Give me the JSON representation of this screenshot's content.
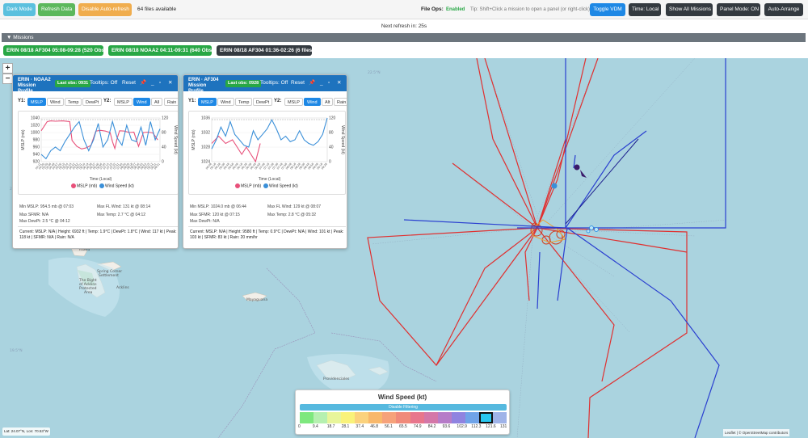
{
  "toolbar": {
    "dark_mode": "Dark Mode",
    "refresh_data": "Refresh Data",
    "disable_auto_refresh": "Disable Auto-refresh",
    "files_available": "64 files available",
    "file_ops_label": "File Ops:",
    "file_ops_status": "Enabled",
    "tip": "Tip: Shift+Click a mission to open a panel (or right-click)",
    "toggle_vdm": "Toggle VDM",
    "time_mode": "Time: Local",
    "show_all_missions": "Show All Missions",
    "panel_mode": "Panel Mode: ON",
    "auto_arrange": "Auto-Arrange",
    "colors": {
      "dark_mode": "#5bc0de",
      "refresh": "#5cb85c",
      "disable_refresh": "#f0ad4e",
      "toggle_vdm": "#1e88e5",
      "dark": "#343a40",
      "enabled": "#28a745"
    }
  },
  "refresh": {
    "text": "Next refresh in: 25s"
  },
  "missions": {
    "header": "▼ Missions",
    "tabs": [
      {
        "label": "ERIN 08/18 AF304 05:08-09:28 (520 Obs)",
        "color": "#28a745"
      },
      {
        "label": "ERIN 08/18 NOAA2 04:11-09:31 (640 Obs)",
        "color": "#28a745"
      },
      {
        "label": "ERIN 08/18 AF304 01:36-02:26 (6 files)",
        "color": "#343a40"
      }
    ]
  },
  "map": {
    "zoom_in": "+",
    "zoom_out": "−",
    "labels": {
      "island": "Island",
      "bight1": "The Bight",
      "bight2": "of Acklins",
      "bight3": "Protected",
      "bight4": "Area",
      "spring1": "Spring Corner",
      "spring2": "Settlement",
      "acklins": "Acklins",
      "mayaguana": "Mayaguana",
      "providenciales": "Providenciales"
    },
    "lat_labels": [
      "22.5°N",
      "21.0°N",
      "19.5°N"
    ],
    "coords": "Lat: 24.07°N, Lon: 70.53°W",
    "attribution": "Leaflet | © OpenStreetMap contributors"
  },
  "panel_noaa2": {
    "title_line1": "ERIN · NOAA2",
    "title_line2": "Mission Profile",
    "last_obs": "Last obs: 0931",
    "tooltips": "Tooltips: Off",
    "reset": "Reset",
    "y1_label": "Y1:",
    "y2_label": "Y2:",
    "y1_buttons": [
      "MSLP",
      "Wind",
      "Temp",
      "DewPt"
    ],
    "y2_buttons": [
      "MSLP",
      "Wind",
      "All",
      "Rain"
    ],
    "chart_y1_label": "MSLP (mb)",
    "chart_y2_label": "Wind Speed (kt)",
    "chart_x_label": "Time (Local)",
    "y1_ticks": [
      "1040",
      "1020",
      "1000",
      "980",
      "960",
      "940",
      "920"
    ],
    "y2_ticks": [
      "120",
      "80",
      "40",
      "0"
    ],
    "x_ticks": [
      "04:11",
      "04:20",
      "04:29",
      "04:38",
      "04:48",
      "04:57",
      "05:06",
      "05:15",
      "05:24",
      "05:33",
      "05:42",
      "05:52",
      "06:01",
      "06:10",
      "06:19",
      "06:28",
      "06:37",
      "06:46",
      "06:56",
      "07:05",
      "07:14",
      "07:23",
      "07:32",
      "07:41",
      "07:50",
      "08:00",
      "08:09",
      "08:18",
      "08:27",
      "08:36",
      "08:45",
      "08:54",
      "09:03",
      "09:12",
      "09:21",
      "09:31"
    ],
    "legend_mslp": "MSLP (mb)",
    "legend_wind": "Wind Speed (kt)",
    "stats": {
      "min_mslp": "Min MSLP: 954.5 mb @ 07:03",
      "max_fl_wind": "Max FL Wind: 131 kt @ 08:14",
      "max_sfmr": "Max SFMR: N/A",
      "max_temp": "Max Temp: 2.7 °C @ 04:12",
      "max_dewpt": "Max DewPt: 2.5 °C @ 04:12"
    },
    "current": "Current: MSLP: N/A | Height: 6932 ft | Temp: 1.9°C | DewPt: 1.8°C | Wind: 117 kt | Peak: 118 kt | SFMR: N/A | Rain: N/A"
  },
  "panel_af304": {
    "title_line1": "ERIN · AF304",
    "title_line2": "Mission Profile",
    "last_obs": "Last obs: 0928",
    "tooltips": "Tooltips: Off",
    "reset": "Reset",
    "y1_label": "Y1:",
    "y2_label": "Y2:",
    "y1_buttons": [
      "MSLP",
      "Wind",
      "Temp",
      "DewPt"
    ],
    "y2_buttons": [
      "MSLP",
      "Wind",
      "Alt",
      "Rain"
    ],
    "chart_y1_label": "MSLP (mb)",
    "chart_y2_label": "Wind Speed (kt)",
    "chart_x_label": "Time (Local)",
    "y1_ticks": [
      "1036",
      "1032",
      "1028",
      "1024"
    ],
    "y2_ticks": [
      "120",
      "80",
      "40",
      "0"
    ],
    "x_ticks": [
      "05:08",
      "05:18",
      "05:28",
      "05:38",
      "05:48",
      "05:58",
      "06:08",
      "06:18",
      "06:28",
      "06:38",
      "06:48",
      "06:58",
      "07:08",
      "07:18",
      "07:28",
      "07:38",
      "07:48",
      "07:58",
      "08:08",
      "08:18",
      "08:28",
      "08:38",
      "08:48",
      "08:58",
      "09:08",
      "09:18",
      "09:28"
    ],
    "legend_mslp": "MSLP (mb)",
    "legend_wind": "Wind Speed (kt)",
    "stats": {
      "min_mslp": "Min MSLP: 1024.0 mb @ 06:44",
      "max_fl_wind": "Max FL Wind: 129 kt @ 08:07",
      "max_sfmr": "Max SFMR: 120 kt @ 07:15",
      "max_temp": "Max Temp: 2.8 °C @ 05:32",
      "max_dewpt": "Max DewPt: N/A"
    },
    "current": "Current: MSLP: N/A | Height: 9580 ft | Temp: 0.9°C | DewPt: N/A | Wind: 101 kt | Peak: 103 kt | SFMR: 83 kt | Rain: 20 mm/hr"
  },
  "wind_legend": {
    "title": "Wind Speed (kt)",
    "filter_button": "Disable Filtering",
    "ticks": [
      "0",
      "9.4",
      "18.7",
      "28.1",
      "37.4",
      "46.8",
      "56.1",
      "65.5",
      "74.9",
      "84.2",
      "93.6",
      "102.9",
      "112.3",
      "121.6",
      "131"
    ],
    "colors": [
      "#7ee87e",
      "#b6f0b0",
      "#e8f59a",
      "#f9f27a",
      "#fbd27d",
      "#f8b86b",
      "#f6a27a",
      "#f08a7a",
      "#e8768c",
      "#d477a8",
      "#b67cc8",
      "#8f83e0",
      "#6fa3e8",
      "#28c8f0",
      "#9fb3e8"
    ],
    "selected_index": 13
  },
  "chart_data": [
    {
      "type": "line",
      "title": "",
      "xlabel": "Time (Local)",
      "ylabel": "MSLP (mb)",
      "y2label": "Wind Speed (kt)",
      "ylim": [
        920,
        1040
      ],
      "y2lim": [
        0,
        120
      ],
      "series": [
        {
          "name": "MSLP (mb)",
          "axis": "y1",
          "color": "#e8507a",
          "x": [
            0,
            0.05,
            0.08,
            0.12,
            0.18,
            0.24,
            0.26,
            0.3,
            0.34,
            0.38,
            0.42,
            0.46,
            0.5,
            0.54,
            0.58,
            0.6,
            0.62,
            0.64,
            0.66,
            0.7,
            0.74,
            0.78,
            0.82,
            0.86,
            0.9,
            0.94,
            0.98
          ],
          "y": [
            1005,
            1030,
            1032,
            1031,
            1032,
            1030,
            978,
            962,
            955,
            958,
            965,
            1004,
            1006,
            1004,
            1000,
            975,
            956,
            985,
            1005,
            1004,
            1000,
            1001,
            962,
            1000,
            1001,
            999,
            980
          ]
        },
        {
          "name": "Wind Speed (kt)",
          "axis": "y2",
          "color": "#3a8fd8",
          "x": [
            0,
            0.04,
            0.08,
            0.12,
            0.16,
            0.2,
            0.24,
            0.28,
            0.32,
            0.36,
            0.4,
            0.44,
            0.48,
            0.52,
            0.56,
            0.6,
            0.64,
            0.68,
            0.72,
            0.76,
            0.8,
            0.84,
            0.88,
            0.92,
            0.96,
            1.0
          ],
          "y": [
            20,
            8,
            30,
            40,
            30,
            55,
            75,
            95,
            110,
            60,
            30,
            60,
            105,
            40,
            60,
            110,
            65,
            45,
            100,
            60,
            55,
            95,
            45,
            110,
            60,
            90
          ]
        }
      ]
    },
    {
      "type": "line",
      "title": "",
      "xlabel": "Time (Local)",
      "ylabel": "MSLP (mb)",
      "y2label": "Wind Speed (kt)",
      "ylim": [
        1024,
        1036
      ],
      "y2lim": [
        0,
        120
      ],
      "series": [
        {
          "name": "MSLP (mb)",
          "axis": "y1",
          "color": "#e8507a",
          "x": [
            0.0,
            0.06,
            0.12,
            0.18,
            0.22,
            0.26,
            0.3,
            0.34,
            0.38,
            0.42
          ],
          "y": [
            1029,
            1031,
            1029,
            1030,
            1028,
            1026,
            1028,
            1026,
            1024,
            1029
          ]
        },
        {
          "name": "Wind Speed (kt)",
          "axis": "y2",
          "color": "#3a8fd8",
          "x": [
            0.0,
            0.04,
            0.08,
            0.12,
            0.16,
            0.2,
            0.24,
            0.28,
            0.32,
            0.36,
            0.4,
            0.44,
            0.48,
            0.52,
            0.56,
            0.6,
            0.64,
            0.68,
            0.72,
            0.76,
            0.8,
            0.84,
            0.88,
            0.92,
            0.96,
            1.0
          ],
          "y": [
            35,
            60,
            95,
            70,
            110,
            75,
            60,
            45,
            40,
            85,
            60,
            75,
            90,
            115,
            90,
            60,
            70,
            55,
            60,
            85,
            60,
            50,
            45,
            55,
            75,
            120
          ]
        }
      ]
    }
  ]
}
